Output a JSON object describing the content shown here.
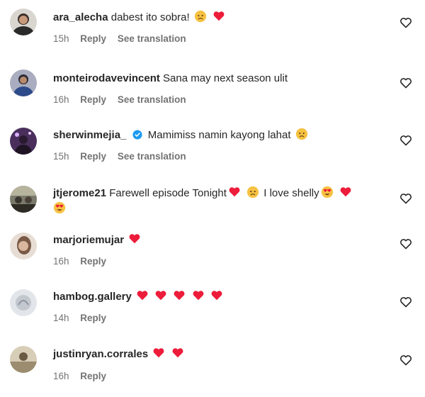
{
  "comments": [
    {
      "username": "ara_alecha",
      "text": "dabest ito sobra!",
      "emojis_after": [
        "sad",
        "heart"
      ],
      "time": "15h",
      "reply": "Reply",
      "translate": "See translation",
      "avatar_color": "#3b3a3a"
    },
    {
      "username": "monteirodavevincent",
      "text": "Sana may next season ulit",
      "emojis_after": [],
      "time": "16h",
      "reply": "Reply",
      "translate": "See translation",
      "avatar_color": "#8b8fa8"
    },
    {
      "username": "sherwinmejia_",
      "verified": true,
      "text": "Mamimiss namin kayong lahat",
      "emojis_after": [
        "sad"
      ],
      "time": "15h",
      "reply": "Reply",
      "translate": "See translation",
      "avatar_color": "#5a3d6e"
    },
    {
      "username": "jtjerome21",
      "text_parts": [
        "Farewell episode Tonight",
        "I love shelly"
      ],
      "time": "",
      "reply": "",
      "translate": "",
      "avatar_color": "#6b6b5e"
    },
    {
      "username": "marjoriemujar",
      "text": "",
      "emojis_after": [
        "heart"
      ],
      "time": "16h",
      "reply": "Reply",
      "translate": "",
      "avatar_color": "#c9b6a8"
    },
    {
      "username": "hambog.gallery",
      "text": "",
      "emojis_after": [
        "heart",
        "heart",
        "heart",
        "heart",
        "heart"
      ],
      "time": "14h",
      "reply": "Reply",
      "translate": "",
      "avatar_color": "#cfd3d8"
    },
    {
      "username": "justinryan.corrales",
      "text": "",
      "emojis_after": [
        "heart",
        "heart"
      ],
      "time": "16h",
      "reply": "Reply",
      "translate": "",
      "avatar_color": "#b5a78e"
    }
  ],
  "colors": {
    "text": "#262626",
    "muted": "#737373",
    "heart": "#ed1c3a",
    "verified": "#1d9bf0"
  }
}
